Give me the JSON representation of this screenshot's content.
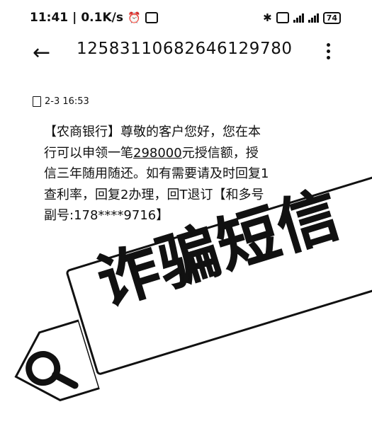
{
  "status_bar": {
    "time": "11:41",
    "network_speed": "0.1K/s",
    "battery": "74",
    "icons": [
      "alarm-icon",
      "app-icon",
      "bluetooth-icon",
      "vibrate-icon",
      "signal-icon",
      "signal-icon-2"
    ]
  },
  "app_bar": {
    "back_icon": "←",
    "sender_number": "12583110682646129780",
    "more_icon": "menu-icon"
  },
  "message": {
    "timestamp": "2-3 16:53",
    "text_before": "【农商银行】尊敬的客户您好，您在本行可以申领一笔",
    "amount": "298000",
    "text_after": "元授信额，授信三年随用随还。如有需要请及时回复1查利率，回复2办理，回T退订【和多号副号:178****9716】"
  },
  "overlay": {
    "label": "诈骗短信"
  }
}
